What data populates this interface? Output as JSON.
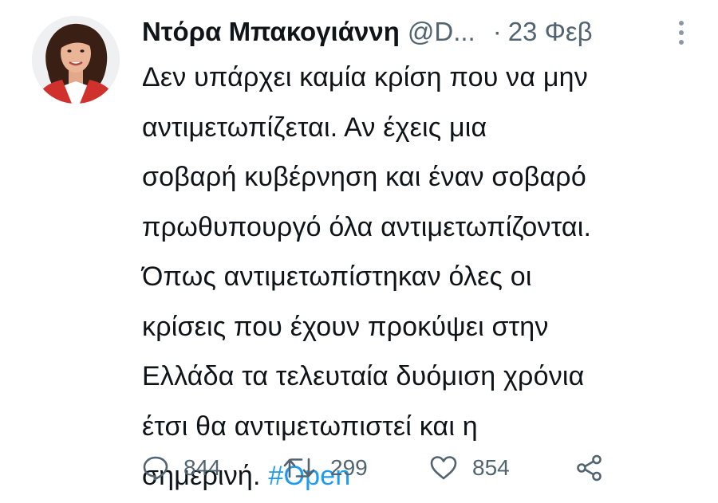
{
  "tweet": {
    "author_name": "Ντόρα Μπακογιάννη",
    "handle": "@D...",
    "separator": "·",
    "date": "23 Φεβ",
    "text_lines": [
      "Δεν υπάρχει καμία κρίση που να μην",
      "αντιμετωπίζεται. Αν έχεις μια",
      "σοβαρή κυβέρνηση και έναν σοβαρό",
      "πρωθυπουργό όλα αντιμετωπίζονται.",
      "Όπως αντιμετωπίστηκαν όλες οι",
      "κρίσεις που έχουν προκύψει στην",
      "Ελλάδα τα τελευταία δυόμιση χρόνια",
      "έτσι θα αντιμετωπιστεί και η"
    ],
    "last_line_text": "σημερινή. ",
    "hashtag": "#Open",
    "replies": "844",
    "retweets": "299",
    "likes": "854"
  },
  "icons": {
    "more": "more-vertical-icon",
    "reply": "reply-icon",
    "retweet": "retweet-icon",
    "like": "heart-icon",
    "share": "share-icon"
  },
  "colors": {
    "text": "#0f1419",
    "secondary": "#536471",
    "link": "#1d9bf0",
    "avatar_accent": "#d0312d"
  }
}
